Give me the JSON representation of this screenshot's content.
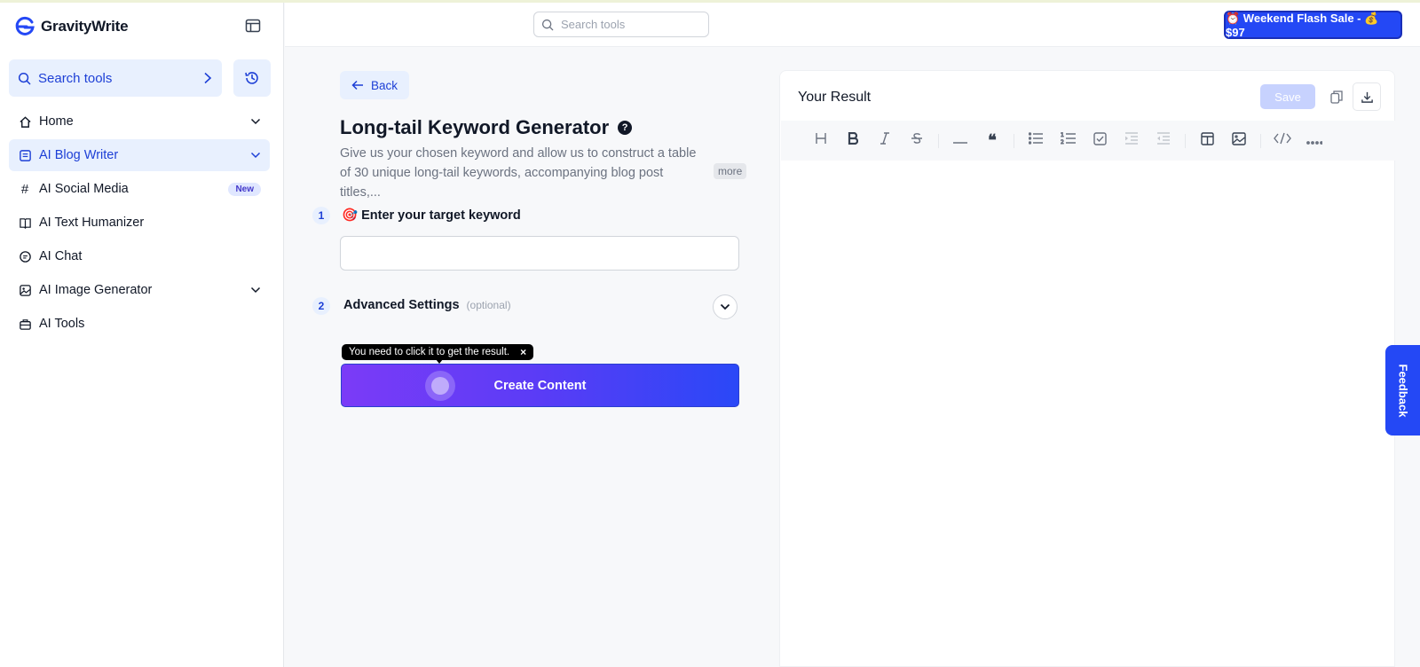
{
  "brand": {
    "name": "GravityWrite"
  },
  "header": {
    "search_placeholder": "Search tools",
    "sale_label": "⏰ Weekend Flash Sale - 💰 $97"
  },
  "sidebar": {
    "search_label": "Search tools",
    "items": [
      {
        "label": "Home",
        "icon": "home-icon",
        "has_chevron": true
      },
      {
        "label": "AI Blog Writer",
        "icon": "document-icon",
        "has_chevron": true,
        "active": true
      },
      {
        "label": "AI Social Media",
        "icon": "hash-icon",
        "badge": "New"
      },
      {
        "label": "AI Text Humanizer",
        "icon": "book-icon"
      },
      {
        "label": "AI Chat",
        "icon": "chat-icon"
      },
      {
        "label": "AI Image Generator",
        "icon": "image-icon",
        "has_chevron": true
      },
      {
        "label": "AI Tools",
        "icon": "briefcase-icon"
      }
    ]
  },
  "tool": {
    "back_label": "Back",
    "title": "Long-tail Keyword Generator",
    "help_glyph": "?",
    "description": "Give us your chosen keyword and allow us to construct a table of 30 unique long-tail keywords, accompanying blog post titles,...",
    "more_label": "more",
    "steps": [
      {
        "num": "1",
        "label": "🎯 Enter your target keyword"
      },
      {
        "num": "2",
        "label": "Advanced Settings",
        "optional": "(optional)"
      }
    ],
    "keyword_value": "",
    "tooltip": "You need to click it to get the result.",
    "tooltip_close": "×",
    "create_label": "Create Content"
  },
  "result": {
    "title": "Your Result",
    "save_label": "Save"
  },
  "feedback_label": "Feedback",
  "colors": {
    "accent": "#2448F5",
    "active_bg": "#E8F0FE",
    "gradient_start": "#7B3BF7",
    "gradient_end": "#2A48F7"
  }
}
